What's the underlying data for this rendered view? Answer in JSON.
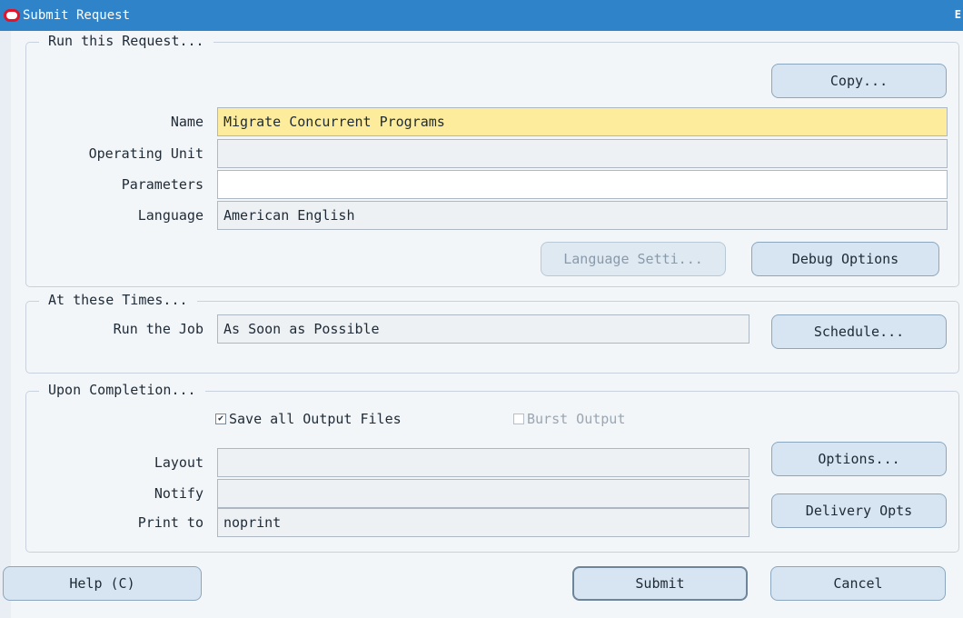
{
  "window": {
    "title": "Submit Request",
    "corner_letter": "E"
  },
  "run_request": {
    "legend": "Run this Request...",
    "copy_button": "Copy...",
    "name_label": "Name",
    "name_value": "Migrate Concurrent Programs",
    "operating_unit_label": "Operating Unit",
    "operating_unit_value": "",
    "parameters_label": "Parameters",
    "parameters_value": "",
    "language_label": "Language",
    "language_value": "American English",
    "language_settings_button": "Language Setti...",
    "debug_options_button": "Debug Options"
  },
  "times": {
    "legend": "At these Times...",
    "run_job_label": "Run the Job",
    "run_job_value": "As Soon as Possible",
    "schedule_button": "Schedule..."
  },
  "completion": {
    "legend": "Upon Completion...",
    "save_output_label": "Save all Output Files",
    "save_output_checked": true,
    "burst_output_label": "Burst Output",
    "burst_output_checked": false,
    "layout_label": "Layout",
    "layout_value": "",
    "notify_label": "Notify",
    "notify_value": "",
    "print_to_label": "Print to",
    "print_to_value": "noprint",
    "options_button": "Options...",
    "delivery_opts_button": "Delivery Opts"
  },
  "footer": {
    "help_button": "Help (C)",
    "submit_button": "Submit",
    "cancel_button": "Cancel"
  },
  "colors": {
    "titlebar": "#2f84c9",
    "required_field": "#fcec9c",
    "button": "#d6e5f1"
  }
}
